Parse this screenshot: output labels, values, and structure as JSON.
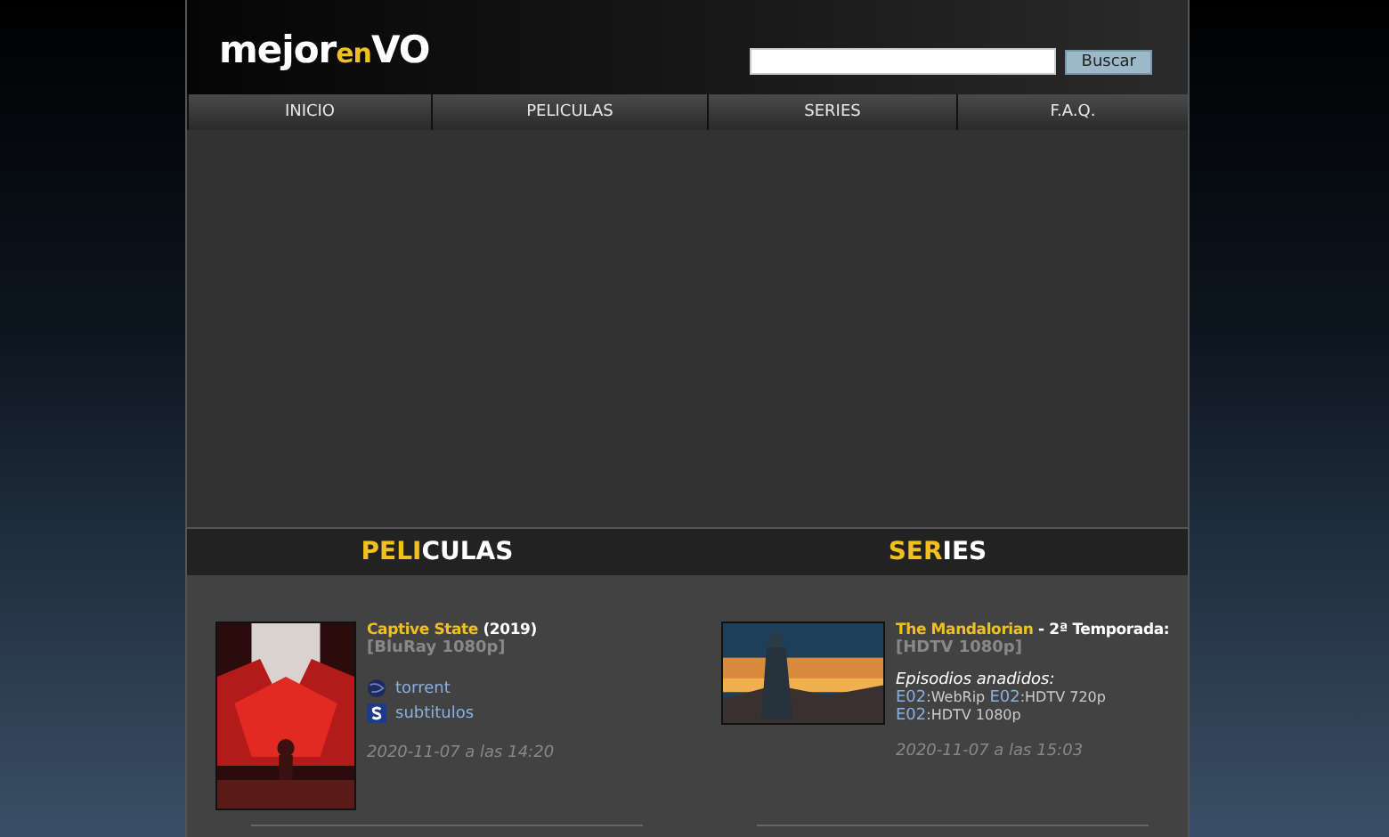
{
  "logo": {
    "parts": [
      "mejor",
      "en",
      "VO"
    ]
  },
  "search": {
    "button": "Buscar"
  },
  "nav": [
    {
      "label": "INICIO"
    },
    {
      "label": "PELICULAS"
    },
    {
      "label": "SERIES"
    },
    {
      "label": "F.A.Q."
    }
  ],
  "sections": [
    {
      "title_parts": [
        "PELI",
        "CULAS"
      ],
      "entry": {
        "kind": "movie",
        "title": "Captive State",
        "suffix": "(2019)",
        "quality": "[BluRay 1080p]",
        "links": [
          {
            "kind": "torrent",
            "label": "torrent"
          },
          {
            "kind": "subs",
            "label": "subtitulos"
          }
        ],
        "date": "2020-11-07 a las 14:20"
      }
    },
    {
      "title_parts": [
        "SER",
        "IES"
      ],
      "entry": {
        "kind": "series",
        "title": "The Mandalorian",
        "suffix": "- 2ª Temporada:",
        "quality": "[HDTV 1080p]",
        "episodes_label": "Episodios anadidos:",
        "episodes": [
          {
            "code": "E02",
            "quality": ":WebRip"
          },
          {
            "code": "E02",
            "quality": ":HDTV 720p"
          },
          {
            "code": "E02",
            "quality": ":HDTV 1080p"
          }
        ],
        "date": "2020-11-07 a las 15:03"
      }
    }
  ]
}
